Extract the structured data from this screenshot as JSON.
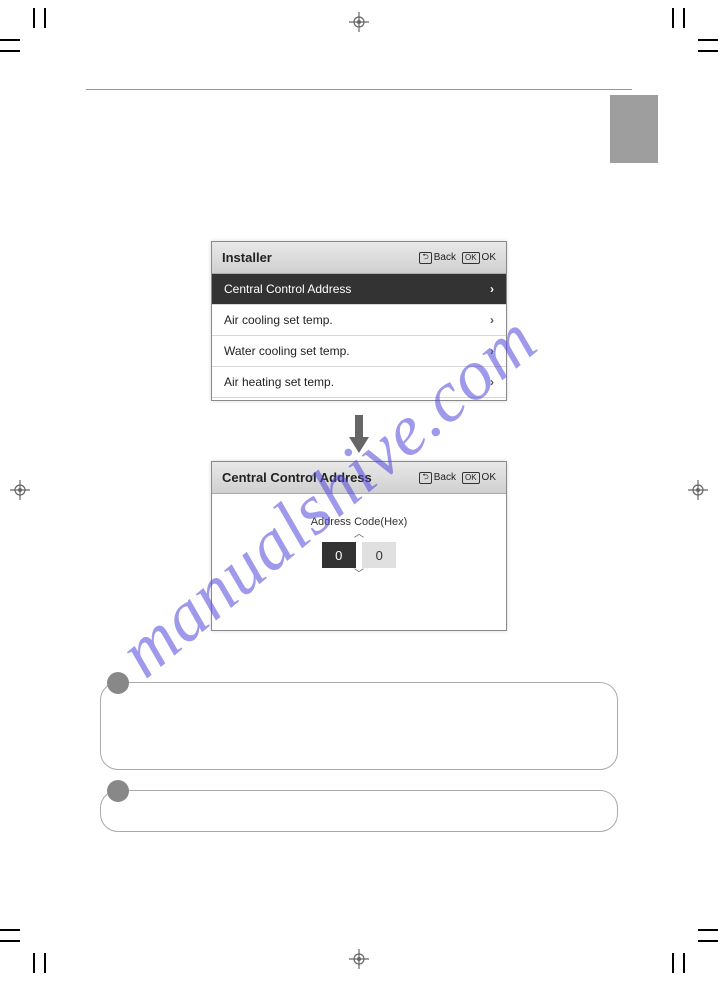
{
  "watermark": "manualshive.com",
  "screen1": {
    "title": "Installer",
    "back": "Back",
    "ok": "OK",
    "items": [
      {
        "label": "Central Control Address",
        "selected": true
      },
      {
        "label": "Air cooling set temp.",
        "selected": false
      },
      {
        "label": "Water cooling set temp.",
        "selected": false
      },
      {
        "label": "Air heating set temp.",
        "selected": false
      }
    ]
  },
  "screen2": {
    "title": "Central Control Address",
    "back": "Back",
    "ok": "OK",
    "addr_label": "Address Code(Hex)",
    "digits": [
      "0",
      "0"
    ]
  },
  "icon_back_glyph": "⤴",
  "icon_ok_glyph": "OK"
}
